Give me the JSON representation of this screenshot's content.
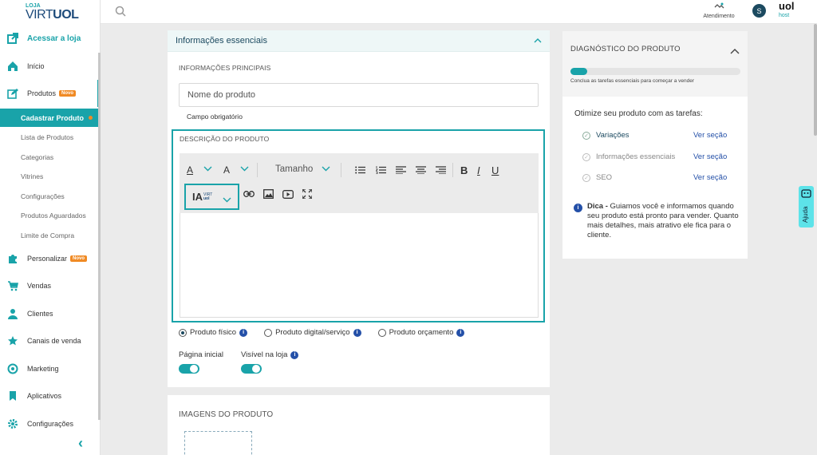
{
  "logo": {
    "small": "LOJA",
    "brand_a": "VIRT",
    "brand_b": "UOL"
  },
  "sidebar": {
    "access": "Acessar a loja",
    "items": [
      {
        "label": "Início"
      },
      {
        "label": "Produtos",
        "badge": "Novo"
      },
      {
        "label": "Personalizar",
        "badge": "Novo"
      },
      {
        "label": "Vendas"
      },
      {
        "label": "Clientes"
      },
      {
        "label": "Canais de venda"
      },
      {
        "label": "Marketing"
      },
      {
        "label": "Aplicativos"
      },
      {
        "label": "Configurações"
      }
    ],
    "products_sub": {
      "active": "Cadastrar Produto",
      "items": [
        "Lista de Produtos",
        "Categorias",
        "Vitrines",
        "Configurações",
        "Produtos Aguardados",
        "Limite de Compra"
      ]
    }
  },
  "topbar": {
    "support": "Atendimento",
    "avatar": "S",
    "uol": "uol",
    "host": "host"
  },
  "card": {
    "title": "Informações essenciais",
    "main_section": "INFORMAÇÕES PRINCIPAIS",
    "name_placeholder": "Nome do produto",
    "required": "Campo obrigatório",
    "desc_section": "DESCRIÇÃO DO PRODUTO",
    "toolbar": {
      "font_a": "A",
      "size": "Tamanho",
      "ia": "IA"
    },
    "product_types": [
      "Produto físico",
      "Produto digital/serviço",
      "Produto orçamento"
    ],
    "selected_type": "Produto físico",
    "toggles": [
      {
        "label": "Página inicial",
        "on": true
      },
      {
        "label": "Visível na loja",
        "on": true
      }
    ]
  },
  "images": {
    "title": "IMAGENS DO PRODUTO"
  },
  "diagnostic": {
    "title": "DIAGNÓSTICO DO PRODUTO",
    "progress": 0.1,
    "subtitle": "Conclua as tarefas essenciais para começar a vender",
    "optimize": "Otimize seu produto com as tarefas:",
    "tasks": [
      {
        "label": "Variações",
        "link": "Ver seção"
      },
      {
        "label": "Informações essenciais",
        "link": "Ver seção"
      },
      {
        "label": "SEO",
        "link": "Ver seção"
      }
    ],
    "tip_bold": "Dica -",
    "tip_text": " Guiamos você e informamos quando seu produto está pronto para vender. Quanto mais detalhes, mais atrativo ele fica para o cliente."
  },
  "help": "Ajuda",
  "colors": {
    "accent": "#19a3a9",
    "badge": "#f08a24",
    "link": "#2450a8"
  }
}
